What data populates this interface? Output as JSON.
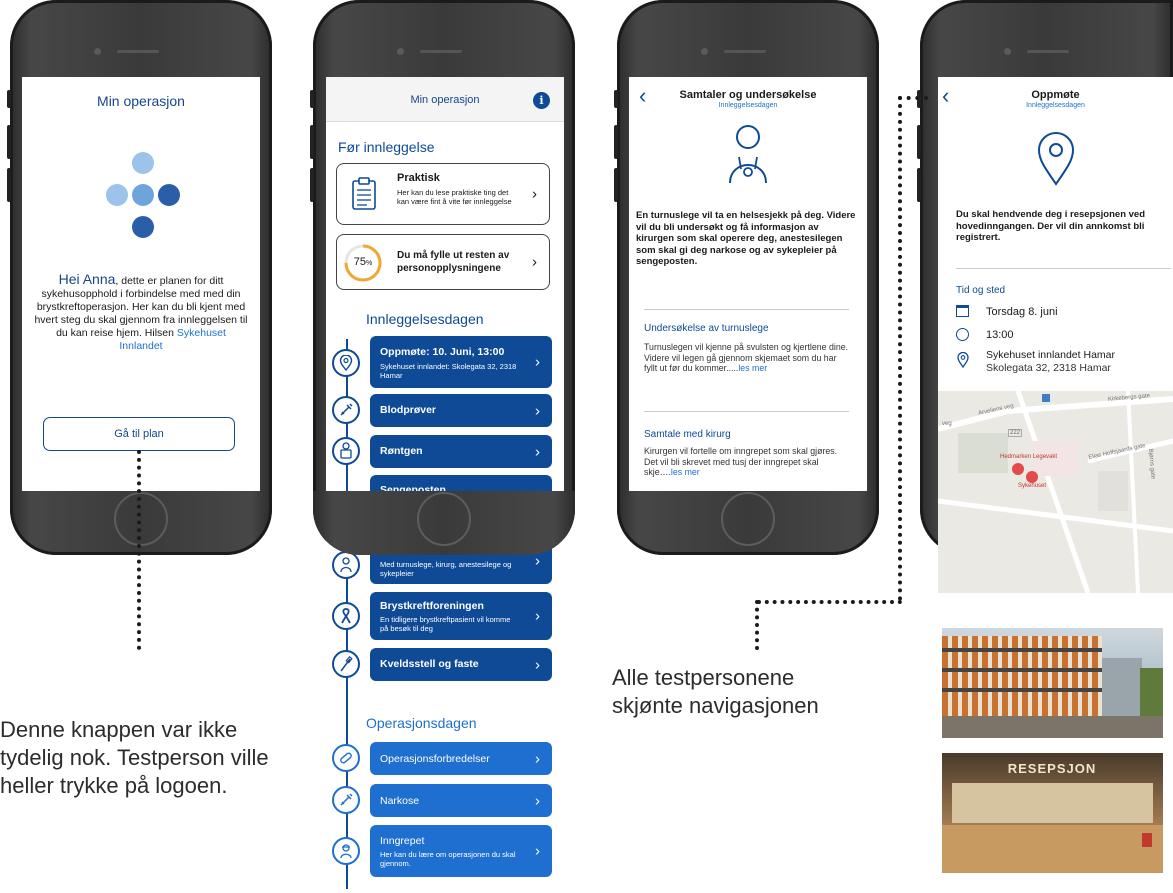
{
  "phone1": {
    "title": "Min operasjon",
    "greeting_name": "Hei Anna",
    "greeting_text": ", dette er planen for ditt sykehusopphold i forbindelse med med din brystkreftoperasjon. Her kan du bli kjent med hvert steg du skal gjennom fra innleggelsen til du kan reise hjem. Hilsen ",
    "signature": "Sykehuset Innlandet",
    "button": "Gå til plan"
  },
  "phone2": {
    "title": "Min operasjon",
    "info_icon": "i",
    "section1": "Før innleggelse",
    "card1_title": "Praktisk",
    "card1_text": "Her kan du lese praktiske ting det kan være fint å vite før innleggelse",
    "card2_progress": "75",
    "card2_progress_unit": "%",
    "card2_text": "Du må fylle ut resten av personopplysningene",
    "section2": "Innleggelsesdagen",
    "step1_title": "Oppmøte: 10. Juni, 13:00",
    "step1_sub": "Sykehuset innlandet: Skolegata 32, 2318 Hamar",
    "step2_title": "Blodprøver",
    "step3_title": "Røntgen",
    "step4_title": "Sengeposten",
    "step5_sub": "Med turnuslege, kirurg, anestesilege og sykepleier",
    "step6_title": "Brystkreftforeningen",
    "step6_sub": "En tidligere brystkreftpasient vil komme på besøk til deg",
    "step7_title": "Kveldsstell og faste",
    "section3": "Operasjonsdagen",
    "step8_title": "Operasjonsforbredelser",
    "step9_title": "Narkose",
    "step10_title": "Inngrepet",
    "step10_sub": "Her kan du lære om operasjonen du skal gjennom."
  },
  "phone3": {
    "title": "Samtaler og undersøkelse",
    "subtitle": "Innleggelsesdagen",
    "intro": "En turnuslege vil ta en helsesjekk på deg. Videre vil du bli undersøkt og få informasjon av kirurgen som skal operere deg, anestesilegen som skal gi deg narkose og av sykepleier på sengeposten.",
    "section1_title": "Undersøkelse av turnuslege",
    "section1_text": "Turnuslegen vil kjenne på svulsten og kjertlene dine. Videre vil legen gå gjennom skjemaet som du har fyllt ut før du kommer.....",
    "section1_link": "les mer",
    "section2_title": "Samtale med kirurg",
    "section2_text": "Kirurgen vil fortelle om inngrepet som skal gjøres. Det vil bli skrevet med tusj der inngrepet skal skje….",
    "section2_link": "les mer"
  },
  "phone4": {
    "title": "Oppmøte",
    "subtitle": "Innleggelsesdagen",
    "intro": "Du skal hendvende deg i resepsjonen ved hovedinngangen. Der vil din annkomst bli registrert.",
    "section_title": "Tid og sted",
    "date": "Torsdag 8. juni",
    "time": "13:00",
    "place": "Sykehuset innlandet Hamar",
    "address": "Skolegata 32, 2318 Hamar"
  },
  "map_labels": {
    "street1": "Arveliens veg",
    "street2": "Kirkebergs gate",
    "street3": "Elias Hoffsjaards gate",
    "street4": "Bjørns gate",
    "veg": "veg",
    "num": "222",
    "poi1": "Hedmarken Legevakt",
    "poi2": "Sykehuset"
  },
  "photo_sign": "RESEPSJON",
  "annotations": {
    "left": "Denne knappen var ikke tydelig nok. Testperson ville heller trykke på logoen.",
    "middle": "Alle testpersonene skjønte navigasjonen"
  },
  "colors": {
    "navy": "#0f4a96",
    "blue": "#1e6fd0",
    "light": "#9cc3ea",
    "mid": "#6fa3db",
    "dark": "#2a5ea8",
    "orange": "#f0a830"
  }
}
